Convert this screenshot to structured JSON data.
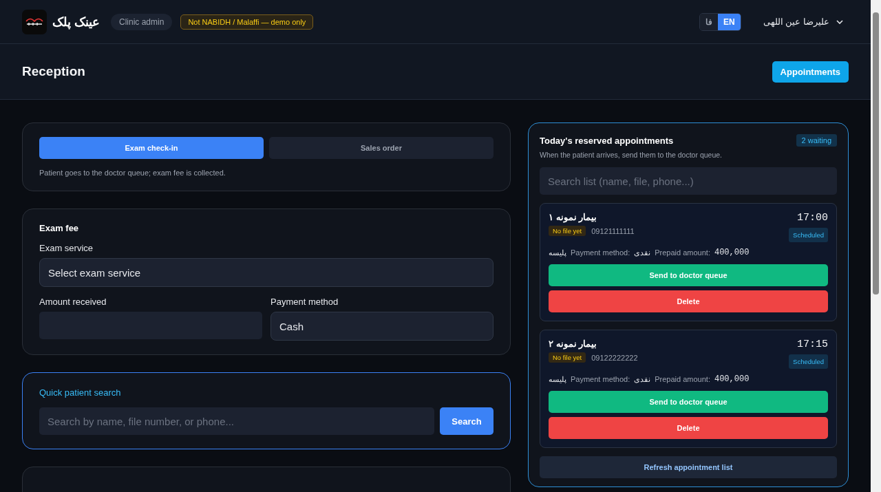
{
  "topbar": {
    "brand": "عینک پلک",
    "role": "Clinic admin",
    "notice": "Not NABIDH / Malaffi — demo only",
    "languages": [
      {
        "label": "فا",
        "selected": false
      },
      {
        "label": "EN",
        "selected": true
      }
    ],
    "user": "علیرضا عین اللهی"
  },
  "page": {
    "title": "Reception",
    "action": "Appointments"
  },
  "mode": {
    "tabs": [
      {
        "label": "Exam check-in",
        "selected": true
      },
      {
        "label": "Sales order",
        "selected": false
      }
    ],
    "hint": "Patient goes to the doctor queue; exam fee is collected."
  },
  "exam_fee": {
    "title": "Exam fee",
    "service_label": "Exam service",
    "service_value": "Select exam service",
    "amount_label": "Amount received",
    "method_label": "Payment method",
    "method_value": "Cash"
  },
  "quick_search": {
    "title": "Quick patient search",
    "placeholder": "Search by name, file number, or phone...",
    "button": "Search"
  },
  "appointments": {
    "title": "Today's reserved appointments",
    "badge": "2 waiting",
    "subtitle": "When the patient arrives, send them to the doctor queue.",
    "search_placeholder": "Search list (name, file, phone...)",
    "items": [
      {
        "name": "بیمار نمونه ۱",
        "time": "17:00",
        "file_tag": "No file yet",
        "phone": "09121111111",
        "status": "Scheduled",
        "insurance": "پلیسه",
        "method_label": "Payment method:",
        "method": "نقدی",
        "prepaid_label": "Prepaid amount:",
        "prepaid": "400,000",
        "send": "Send to doctor queue",
        "delete": "Delete"
      },
      {
        "name": "بیمار نمونه ۲",
        "time": "17:15",
        "file_tag": "No file yet",
        "phone": "09122222222",
        "status": "Scheduled",
        "insurance": "پلیسه",
        "method_label": "Payment method:",
        "method": "نقدی",
        "prepaid_label": "Prepaid amount:",
        "prepaid": "400,000",
        "send": "Send to doctor queue",
        "delete": "Delete"
      }
    ],
    "refresh": "Refresh appointment list"
  }
}
